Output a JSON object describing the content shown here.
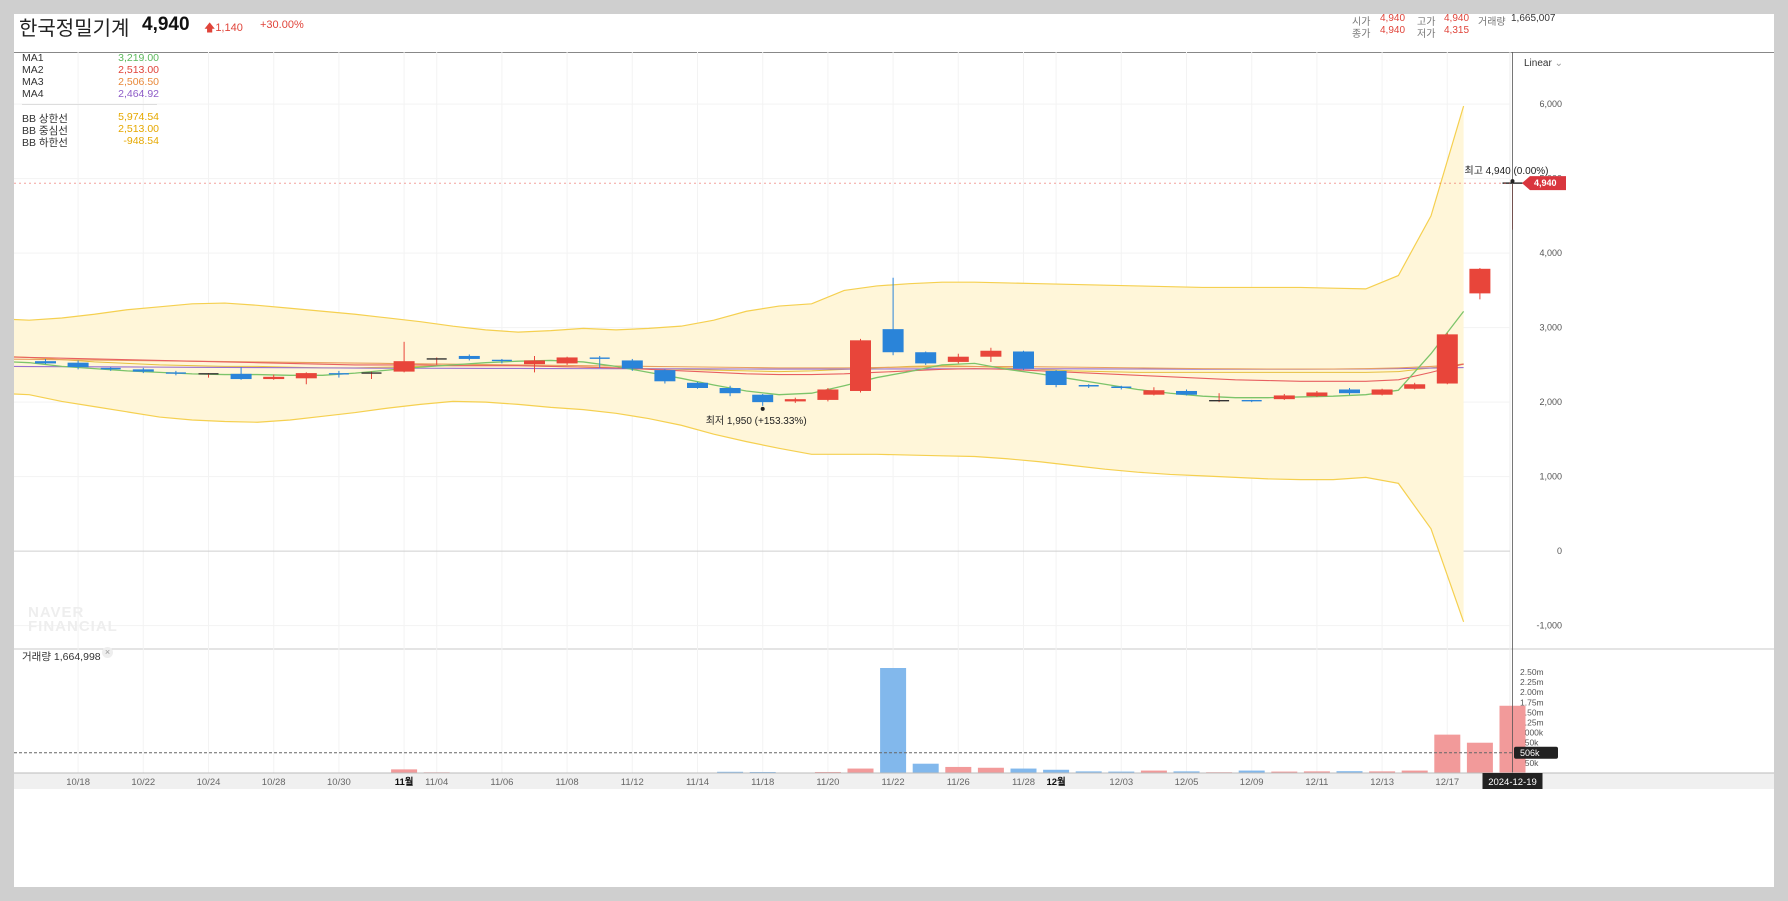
{
  "header": {
    "name": "한국정밀기계",
    "price": "4,940",
    "change": "1,140",
    "change_pct": "+30.00%",
    "open_label": "시가",
    "open_value": "4,940",
    "high_label": "고가",
    "high_value": "4,940",
    "volume_label": "거래량",
    "volume_value": "1,665,007",
    "close_label": "종가",
    "close_value": "4,940",
    "low_label": "저가",
    "low_value": "4,315"
  },
  "legend": {
    "ma": [
      {
        "label": "MA1",
        "value": "3,219.00",
        "color": "#5cb85c"
      },
      {
        "label": "MA2",
        "value": "2,513.00",
        "color": "#e0443a"
      },
      {
        "label": "MA3",
        "value": "2,506.50",
        "color": "#e8893a"
      },
      {
        "label": "MA4",
        "value": "2,464.92",
        "color": "#8e5cc8"
      }
    ],
    "bb": [
      {
        "label": "BB 상한선",
        "value": "5,974.54",
        "color": "#f0b400"
      },
      {
        "label": "BB 중심선",
        "value": "2,513.00",
        "color": "#f0b400"
      },
      {
        "label": "BB 하한선",
        "value": "-948.54",
        "color": "#f0b400"
      }
    ]
  },
  "scale_mode": "Linear",
  "annotations": {
    "high": "최고 4,940 (0.00%)",
    "low": "최저 1,950 (+153.33%)"
  },
  "price_badge": "4,940",
  "volume_badge": "506k",
  "date_badge": "2024-12-19",
  "volume_panel": {
    "label": "거래량",
    "value": "1,664,998"
  },
  "watermark": [
    "NAVER",
    "FINANCIAL"
  ],
  "colors": {
    "up": "#e8453a",
    "down": "#2a84d9",
    "bb_band": "#fff6d9",
    "bb_line": "#f5d050"
  },
  "chart_data": {
    "type": "candlestick",
    "price_axis": {
      "ticks": [
        "6,000",
        "5,000",
        "4,000",
        "3,000",
        "2,000",
        "1,000",
        "0",
        "-1,000"
      ],
      "tick_values": [
        6000,
        5000,
        4000,
        3000,
        2000,
        1000,
        0,
        -1000
      ],
      "ylim": [
        -1300,
        6700
      ]
    },
    "volume_axis": {
      "ticks": [
        "2.50m",
        "2.25m",
        "2.00m",
        "1.75m",
        "1.50m",
        "1.25m",
        "1000k",
        "750k",
        "500k",
        "250k"
      ],
      "tick_values": [
        2500000,
        2250000,
        2000000,
        1750000,
        1500000,
        1250000,
        1000000,
        750000,
        500000,
        250000
      ],
      "ylim": [
        0,
        2600000
      ]
    },
    "x_ticks": [
      {
        "label": "10/18",
        "i": 1
      },
      {
        "label": "10/22",
        "i": 3
      },
      {
        "label": "10/24",
        "i": 5
      },
      {
        "label": "10/28",
        "i": 7
      },
      {
        "label": "10/30",
        "i": 9
      },
      {
        "label": "11월",
        "i": 11,
        "bold": true
      },
      {
        "label": "11/04",
        "i": 12
      },
      {
        "label": "11/06",
        "i": 14
      },
      {
        "label": "11/08",
        "i": 16
      },
      {
        "label": "11/12",
        "i": 18
      },
      {
        "label": "11/14",
        "i": 20
      },
      {
        "label": "11/18",
        "i": 22
      },
      {
        "label": "11/20",
        "i": 24
      },
      {
        "label": "11/22",
        "i": 26
      },
      {
        "label": "11/26",
        "i": 28
      },
      {
        "label": "11/28",
        "i": 30
      },
      {
        "label": "12월",
        "i": 31,
        "bold": true
      },
      {
        "label": "12/03",
        "i": 33
      },
      {
        "label": "12/05",
        "i": 35
      },
      {
        "label": "12/09",
        "i": 37
      },
      {
        "label": "12/11",
        "i": 39
      },
      {
        "label": "12/13",
        "i": 41
      },
      {
        "label": "12/17",
        "i": 43
      }
    ],
    "candles": [
      {
        "o": 2550,
        "h": 2580,
        "l": 2510,
        "c": 2520,
        "v": 3000
      },
      {
        "o": 2530,
        "h": 2560,
        "l": 2440,
        "c": 2470,
        "v": 5000
      },
      {
        "o": 2450,
        "h": 2470,
        "l": 2420,
        "c": 2440,
        "v": 3000
      },
      {
        "o": 2440,
        "h": 2460,
        "l": 2390,
        "c": 2410,
        "v": 4000
      },
      {
        "o": 2390,
        "h": 2420,
        "l": 2360,
        "c": 2370,
        "v": 3000
      },
      {
        "o": 2360,
        "h": 2390,
        "l": 2330,
        "c": 2380,
        "v": 3000
      },
      {
        "o": 2380,
        "h": 2470,
        "l": 2300,
        "c": 2310,
        "v": 5000
      },
      {
        "o": 2310,
        "h": 2370,
        "l": 2300,
        "c": 2340,
        "v": 3000
      },
      {
        "o": 2320,
        "h": 2400,
        "l": 2240,
        "c": 2390,
        "v": 3000
      },
      {
        "o": 2380,
        "h": 2420,
        "l": 2330,
        "c": 2370,
        "v": 5000
      },
      {
        "o": 2370,
        "h": 2410,
        "l": 2310,
        "c": 2390,
        "v": 6000
      },
      {
        "o": 2410,
        "h": 2810,
        "l": 2400,
        "c": 2550,
        "v": 90000
      },
      {
        "o": 2570,
        "h": 2600,
        "l": 2500,
        "c": 2580,
        "v": 18000
      },
      {
        "o": 2620,
        "h": 2640,
        "l": 2560,
        "c": 2580,
        "v": 8000
      },
      {
        "o": 2560,
        "h": 2580,
        "l": 2520,
        "c": 2540,
        "v": 6000
      },
      {
        "o": 2510,
        "h": 2620,
        "l": 2400,
        "c": 2560,
        "v": 8000
      },
      {
        "o": 2520,
        "h": 2610,
        "l": 2500,
        "c": 2600,
        "v": 6000
      },
      {
        "o": 2590,
        "h": 2620,
        "l": 2460,
        "c": 2580,
        "v": 5000
      },
      {
        "o": 2560,
        "h": 2580,
        "l": 2420,
        "c": 2450,
        "v": 8000
      },
      {
        "o": 2430,
        "h": 2440,
        "l": 2250,
        "c": 2280,
        "v": 12000
      },
      {
        "o": 2260,
        "h": 2270,
        "l": 2180,
        "c": 2190,
        "v": 8000
      },
      {
        "o": 2190,
        "h": 2220,
        "l": 2080,
        "c": 2120,
        "v": 30000
      },
      {
        "o": 2100,
        "h": 2110,
        "l": 1950,
        "c": 2000,
        "v": 25000
      },
      {
        "o": 2010,
        "h": 2060,
        "l": 1990,
        "c": 2040,
        "v": 12000
      },
      {
        "o": 2030,
        "h": 2190,
        "l": 2010,
        "c": 2170,
        "v": 25000
      },
      {
        "o": 2150,
        "h": 2850,
        "l": 2130,
        "c": 2830,
        "v": 110000
      },
      {
        "o": 2980,
        "h": 3670,
        "l": 2630,
        "c": 2670,
        "v": 2600000
      },
      {
        "o": 2670,
        "h": 2680,
        "l": 2500,
        "c": 2520,
        "v": 230000
      },
      {
        "o": 2540,
        "h": 2650,
        "l": 2520,
        "c": 2610,
        "v": 150000
      },
      {
        "o": 2610,
        "h": 2730,
        "l": 2540,
        "c": 2690,
        "v": 130000
      },
      {
        "o": 2680,
        "h": 2690,
        "l": 2430,
        "c": 2450,
        "v": 110000
      },
      {
        "o": 2420,
        "h": 2430,
        "l": 2200,
        "c": 2230,
        "v": 80000
      },
      {
        "o": 2220,
        "h": 2240,
        "l": 2190,
        "c": 2210,
        "v": 40000
      },
      {
        "o": 2200,
        "h": 2220,
        "l": 2170,
        "c": 2180,
        "v": 35000
      },
      {
        "o": 2100,
        "h": 2200,
        "l": 2090,
        "c": 2160,
        "v": 60000
      },
      {
        "o": 2150,
        "h": 2170,
        "l": 2090,
        "c": 2100,
        "v": 40000
      },
      {
        "o": 2020,
        "h": 2120,
        "l": 2000,
        "c": 2020,
        "v": 20000
      },
      {
        "o": 2020,
        "h": 2030,
        "l": 2000,
        "c": 2010,
        "v": 60000
      },
      {
        "o": 2040,
        "h": 2110,
        "l": 2030,
        "c": 2090,
        "v": 35000
      },
      {
        "o": 2080,
        "h": 2150,
        "l": 2070,
        "c": 2130,
        "v": 40000
      },
      {
        "o": 2170,
        "h": 2190,
        "l": 2100,
        "c": 2120,
        "v": 45000
      },
      {
        "o": 2100,
        "h": 2180,
        "l": 2090,
        "c": 2170,
        "v": 40000
      },
      {
        "o": 2180,
        "h": 2260,
        "l": 2170,
        "c": 2240,
        "v": 60000
      },
      {
        "o": 2250,
        "h": 2930,
        "l": 2240,
        "c": 2910,
        "v": 950000
      },
      {
        "o": 3460,
        "h": 3800,
        "l": 3380,
        "c": 3790,
        "v": 750000
      },
      {
        "o": 4940,
        "h": 4940,
        "l": 4315,
        "c": 4940,
        "v": 1664998
      }
    ],
    "volume_colors": "up candles red, down candles blue",
    "bollinger": {
      "upper": [
        3120,
        3100,
        3130,
        3180,
        3240,
        3280,
        3320,
        3330,
        3300,
        3260,
        3220,
        3180,
        3130,
        3080,
        3020,
        2970,
        2940,
        2960,
        2990,
        2970,
        2990,
        3020,
        3100,
        3220,
        3290,
        3320,
        3500,
        3560,
        3590,
        3610,
        3610,
        3600,
        3590,
        3580,
        3570,
        3560,
        3550,
        3540,
        3540,
        3540,
        3540,
        3530,
        3520,
        3700,
        4500,
        5974.54
      ],
      "middle": [
        2620,
        2600,
        2570,
        2540,
        2520,
        2500,
        2490,
        2480,
        2480,
        2470,
        2460,
        2460,
        2470,
        2480,
        2490,
        2490,
        2490,
        2480,
        2470,
        2460,
        2450,
        2440,
        2430,
        2420,
        2410,
        2420,
        2440,
        2460,
        2480,
        2490,
        2480,
        2460,
        2440,
        2420,
        2410,
        2400,
        2400,
        2400,
        2400,
        2400,
        2400,
        2400,
        2400,
        2410,
        2460,
        2513.0
      ],
      "lower": [
        2120,
        2100,
        2010,
        1940,
        1870,
        1800,
        1760,
        1740,
        1730,
        1760,
        1810,
        1860,
        1920,
        1970,
        2010,
        2000,
        1970,
        1930,
        1900,
        1850,
        1780,
        1690,
        1570,
        1470,
        1380,
        1300,
        1300,
        1300,
        1290,
        1280,
        1270,
        1240,
        1200,
        1150,
        1100,
        1060,
        1030,
        1010,
        990,
        970,
        960,
        960,
        990,
        910,
        300,
        -948.54
      ]
    },
    "ma_lines": {
      "MA1": [
        2550,
        2530,
        2480,
        2450,
        2420,
        2400,
        2380,
        2370,
        2370,
        2360,
        2360,
        2390,
        2430,
        2470,
        2500,
        2530,
        2550,
        2560,
        2540,
        2480,
        2400,
        2320,
        2230,
        2150,
        2100,
        2120,
        2220,
        2330,
        2410,
        2500,
        2520,
        2440,
        2380,
        2310,
        2240,
        2170,
        2120,
        2080,
        2060,
        2060,
        2070,
        2080,
        2100,
        2160,
        2650,
        3219.0
      ],
      "MA2": [
        2610,
        2600,
        2590,
        2580,
        2570,
        2560,
        2550,
        2540,
        2530,
        2520,
        2510,
        2500,
        2500,
        2500,
        2490,
        2490,
        2490,
        2480,
        2470,
        2460,
        2440,
        2420,
        2400,
        2380,
        2370,
        2370,
        2380,
        2400,
        2420,
        2440,
        2450,
        2440,
        2420,
        2400,
        2380,
        2360,
        2340,
        2320,
        2300,
        2290,
        2280,
        2280,
        2280,
        2300,
        2400,
        2513.0
      ],
      "MA3": [
        2580,
        2575,
        2570,
        2565,
        2560,
        2555,
        2550,
        2545,
        2540,
        2535,
        2530,
        2525,
        2520,
        2515,
        2510,
        2505,
        2500,
        2495,
        2490,
        2485,
        2480,
        2475,
        2470,
        2465,
        2460,
        2460,
        2460,
        2465,
        2470,
        2475,
        2478,
        2478,
        2475,
        2470,
        2465,
        2460,
        2455,
        2450,
        2448,
        2445,
        2445,
        2445,
        2450,
        2460,
        2480,
        2506.5
      ],
      "MA4": [
        2480,
        2478,
        2476,
        2474,
        2472,
        2470,
        2468,
        2466,
        2464,
        2462,
        2460,
        2458,
        2456,
        2455,
        2454,
        2453,
        2452,
        2451,
        2450,
        2449,
        2448,
        2447,
        2446,
        2445,
        2444,
        2444,
        2444,
        2445,
        2446,
        2447,
        2448,
        2448,
        2448,
        2447,
        2446,
        2445,
        2444,
        2443,
        2443,
        2443,
        2443,
        2444,
        2446,
        2450,
        2458,
        2464.92
      ]
    }
  }
}
